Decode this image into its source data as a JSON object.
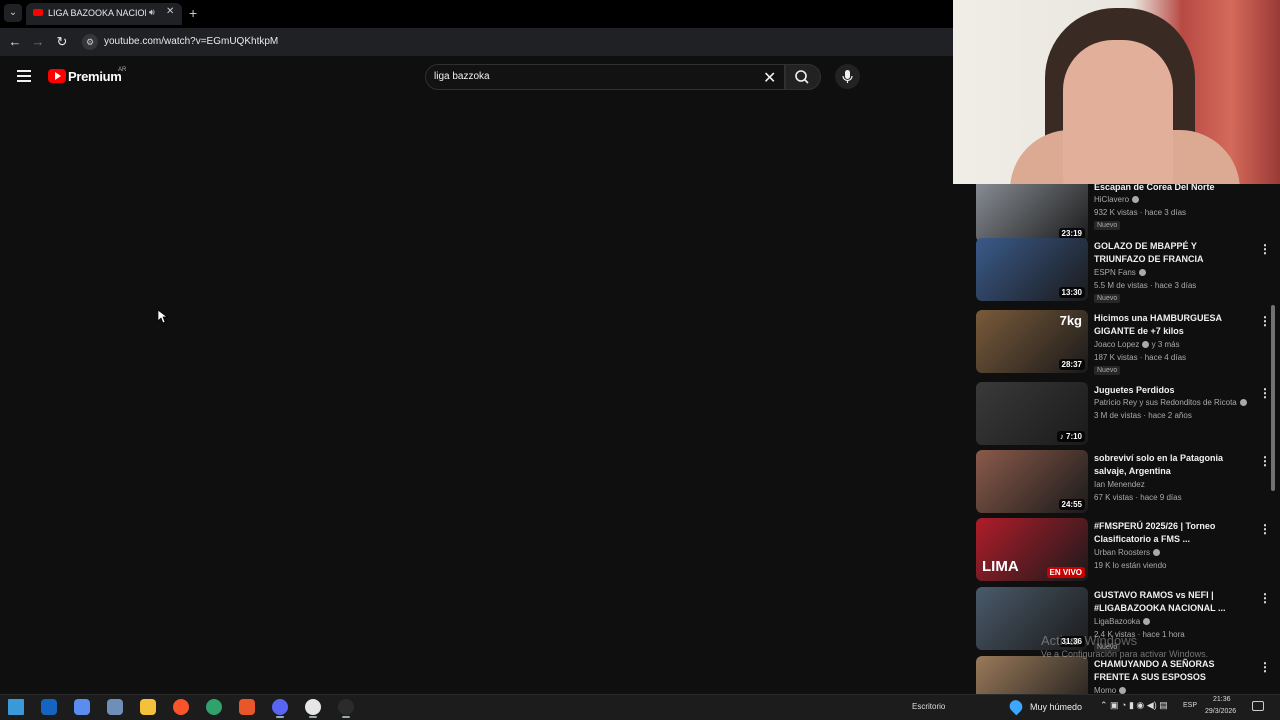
{
  "browser": {
    "tab_title": "LIGA BAZOOKA NACIONAL",
    "url": "youtube.com/watch?v=EGmUQKhtkpM"
  },
  "youtube": {
    "brand": "Premium",
    "region": "AR",
    "search_query": "liga bazzoka"
  },
  "recommendations": [
    {
      "title": "Escapan de Corea Del Norte",
      "channel": "HiClavero",
      "verified": true,
      "meta": "932 K vistas · hace 3 días",
      "badge": "Nuevo",
      "duration": "23:19",
      "thumb_color": "#8a8f96"
    },
    {
      "title": "GOLAZO DE MBAPPÉ Y TRIUNFAZO DE FRANCIA ANT...",
      "channel": "ESPN Fans",
      "verified": true,
      "meta": "5.5 M de vistas · hace 3 días",
      "badge": "Nuevo",
      "duration": "13:30",
      "thumb_color": "#3a5a8a"
    },
    {
      "title": "Hicimos una HAMBURGUESA GIGANTE de +7 kilos",
      "channel": "Joaco Lopez",
      "verified": true,
      "channel_extra": "y 3 más",
      "meta": "187 K vistas · hace 4 días",
      "badge": "Nuevo",
      "duration": "28:37",
      "thumb_color": "#7a5a3a",
      "thumb_label": "7kg"
    },
    {
      "title": "Juguetes Perdidos",
      "channel": "Patricio Rey y sus Redonditos de Ricota",
      "verified": true,
      "meta": "3 M de vistas · hace 2 años",
      "badge": "",
      "duration": "♪ 7:10",
      "thumb_color": "#3a3a3a"
    },
    {
      "title": "sobreviví solo en la Patagonia salvaje, Argentina",
      "channel": "Ian Menendez",
      "verified": false,
      "meta": "67 K vistas · hace 9 días",
      "badge": "",
      "duration": "24:55",
      "thumb_color": "#8a5a4a"
    },
    {
      "title": "#FMSPERÚ 2025/26 | Torneo Clasificatorio a FMS ...",
      "channel": "Urban Roosters",
      "verified": true,
      "meta": "19 K lo están viendo",
      "badge": "",
      "live": "EN VIVO",
      "thumb_color": "#b01c2a",
      "thumb_label": "LIMA"
    },
    {
      "title": "GUSTAVO RAMOS vs NEFI | #LIGABAZOOKA NACIONAL ...",
      "channel": "LigaBazooka",
      "verified": true,
      "meta": "2,4 K vistas · hace 1 hora",
      "badge": "Nuevo",
      "duration": "31:36",
      "thumb_color": "#4a5a6a"
    },
    {
      "title": "CHAMUYANDO A SEÑORAS FRENTE A SUS ESPOSOS",
      "channel": "Momo",
      "verified": true,
      "meta": "",
      "badge": "",
      "duration": "",
      "thumb_color": "#9a7a5a"
    }
  ],
  "watermark": {
    "line1": "Activar Windows",
    "line2": "Ve a Configuración para activar Windows."
  },
  "taskbar": {
    "desktop_label": "Escritorio",
    "weather": "Muy húmedo",
    "language": "ESP",
    "time": "21:36",
    "date": "29/3/2026",
    "apps": [
      "windows-start",
      "outlook",
      "copilot",
      "files",
      "explorer",
      "brave",
      "edge",
      "office",
      "discord",
      "chrome",
      "obs"
    ]
  }
}
